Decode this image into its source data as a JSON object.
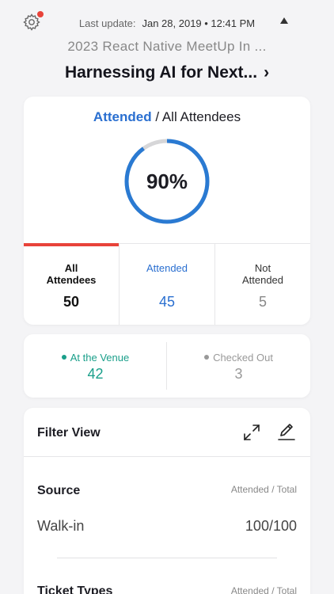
{
  "header": {
    "last_update_label": "Last update:",
    "last_update_value": "Jan 28, 2019 • 12:41 PM",
    "event_name": "2023 React Native MeetUp In ...",
    "session_title": "Harnessing AI for Next...",
    "session_chevron": "›",
    "notification_color": "#e8433a"
  },
  "stats": {
    "heading_active": "Attended",
    "heading_separator": " / ",
    "heading_rest": "All Attendees",
    "percent_label": "90%",
    "percent_value": 0.9,
    "cells": [
      {
        "label_line1": "All",
        "label_line2": "Attendees",
        "value": "50"
      },
      {
        "label_line1": "Attended",
        "label_line2": "",
        "value": "45"
      },
      {
        "label_line1": "Not",
        "label_line2": "Attended",
        "value": "5"
      }
    ]
  },
  "venue": {
    "at_venue_label": "At the Venue",
    "at_venue_value": "42",
    "checked_out_label": "Checked Out",
    "checked_out_value": "3"
  },
  "filter": {
    "title": "Filter View",
    "sections": [
      {
        "title": "Source",
        "meta": "Attended / Total",
        "rows": [
          {
            "label": "Walk-in",
            "value": "100/100"
          }
        ]
      },
      {
        "title": "Ticket Types",
        "meta": "Attended / Total"
      }
    ]
  },
  "colors": {
    "accent_blue": "#2a6fd0",
    "accent_red": "#e8433a",
    "accent_teal": "#1a9f8a"
  }
}
